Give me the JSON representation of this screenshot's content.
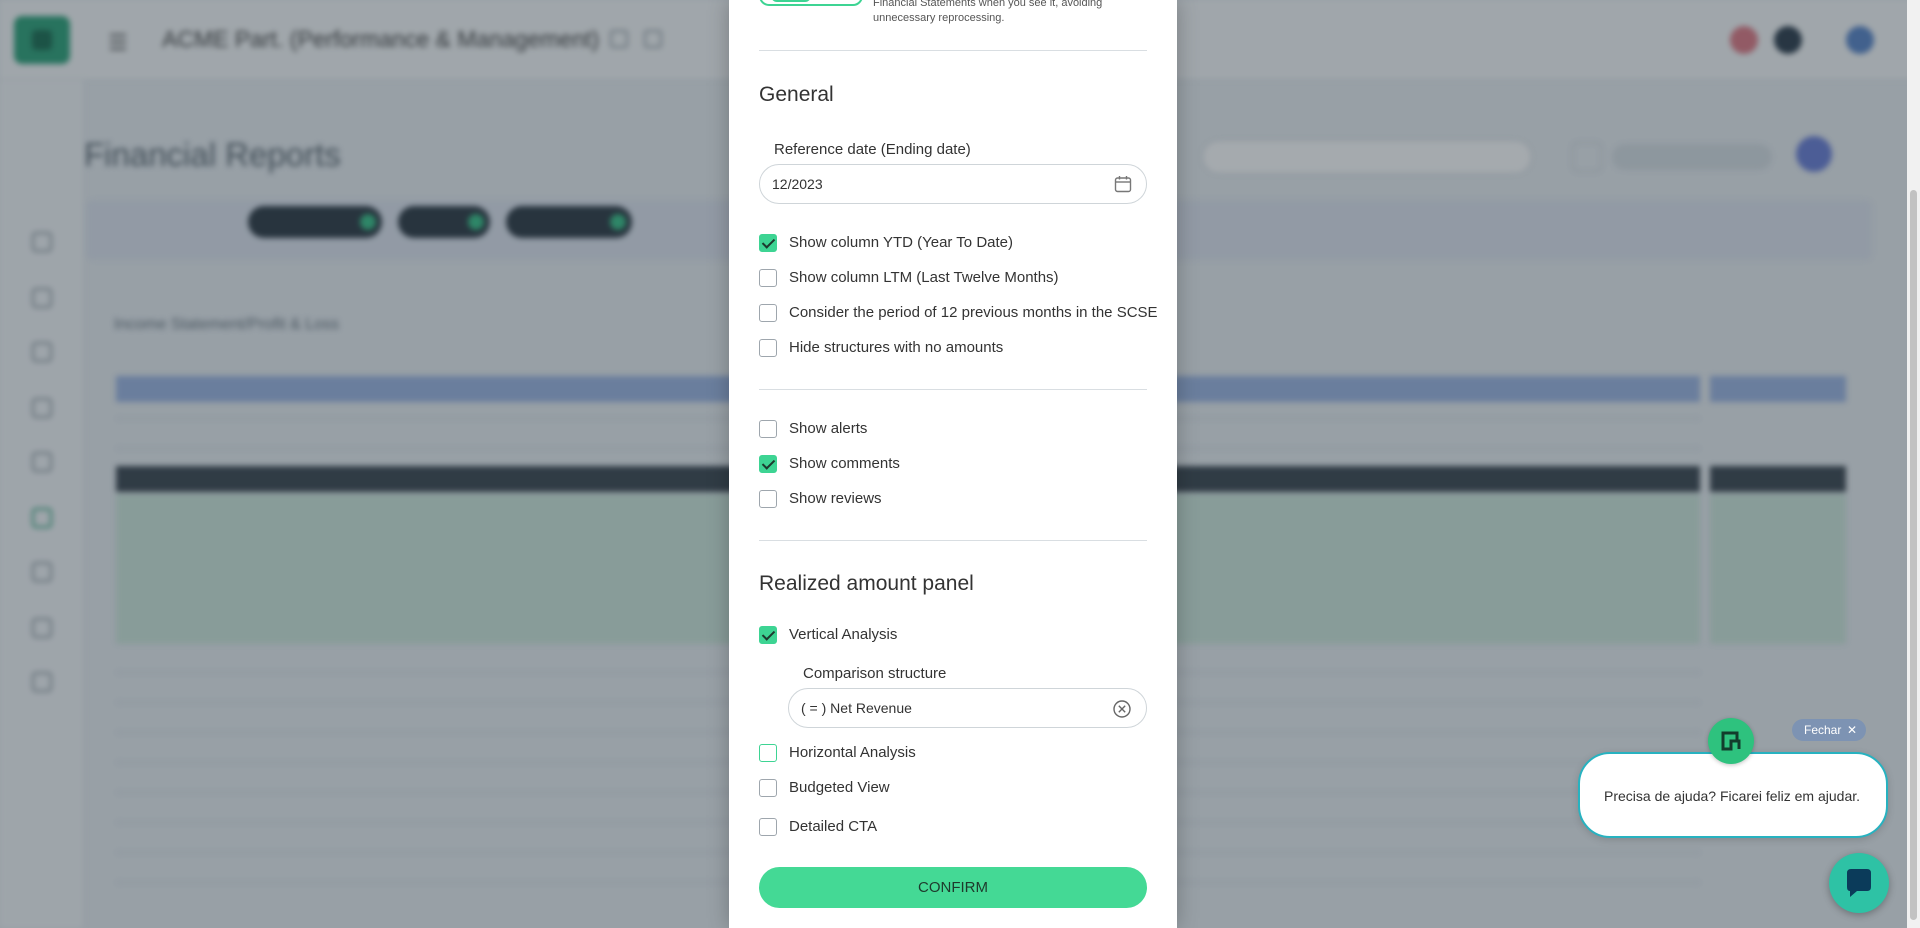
{
  "background": {
    "company_name": "ACME Part. (Performance & Management)",
    "page_title": "Financial Reports",
    "section_title": "Income Statement/Profit & Loss"
  },
  "modal": {
    "help_text": "Financial Statements when you see it, avoiding unnecessary reprocessing.",
    "general": {
      "title": "General",
      "reference_date_label": "Reference date (Ending date)",
      "reference_date_value": "12/2023",
      "checkboxes": [
        {
          "label": "Show column YTD (Year To Date)",
          "checked": true
        },
        {
          "label": "Show column LTM (Last Twelve Months)",
          "checked": false
        },
        {
          "label": "Consider the period of 12 previous months in the SCSE",
          "checked": false
        },
        {
          "label": "Hide structures with no amounts",
          "checked": false
        }
      ]
    },
    "display": {
      "checkboxes": [
        {
          "label": "Show alerts",
          "checked": false
        },
        {
          "label": "Show comments",
          "checked": true
        },
        {
          "label": "Show reviews",
          "checked": false
        }
      ]
    },
    "realized": {
      "title": "Realized amount panel",
      "vertical_analysis": {
        "label": "Vertical Analysis",
        "checked": true
      },
      "comparison_structure_label": "Comparison structure",
      "comparison_structure_value": "( = ) Net Revenue",
      "horizontal_analysis": {
        "label": "Horizontal Analysis",
        "checked": false
      },
      "budgeted_view": {
        "label": "Budgeted View",
        "checked": false
      },
      "detailed_cta": {
        "label": "Detailed CTA",
        "checked": false
      }
    },
    "confirm_label": "CONFIRM"
  },
  "chat": {
    "close_label": "Fechar",
    "message": "Precisa de ajuda? Ficarei feliz em ajudar."
  },
  "colors": {
    "accent": "#3dd493",
    "chat_border": "#27b2c0",
    "fechar_bg": "#7d93b3"
  }
}
